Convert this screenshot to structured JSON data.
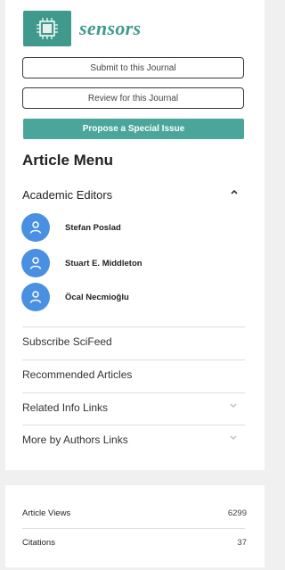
{
  "journal": {
    "name": "sensors",
    "brand_color": "#3f9a8d"
  },
  "buttons": {
    "submit": "Submit to this Journal",
    "review": "Review for this Journal",
    "propose": "Propose a Special Issue",
    "propose_color": "#4aa69b"
  },
  "menu": {
    "title": "Article Menu",
    "academic_editors": {
      "label": "Academic Editors",
      "expanded": true,
      "editors": [
        "Stefan Poslad",
        "Stuart E. Middleton",
        "Öcal Necmioğlu"
      ]
    },
    "links": [
      "Subscribe SciFeed",
      "Recommended Articles",
      "Related Info Links",
      "More by Authors Links"
    ]
  },
  "stats": {
    "rows": [
      {
        "label": "Article Views",
        "value": "6299"
      },
      {
        "label": "Citations",
        "value": "37"
      }
    ]
  }
}
